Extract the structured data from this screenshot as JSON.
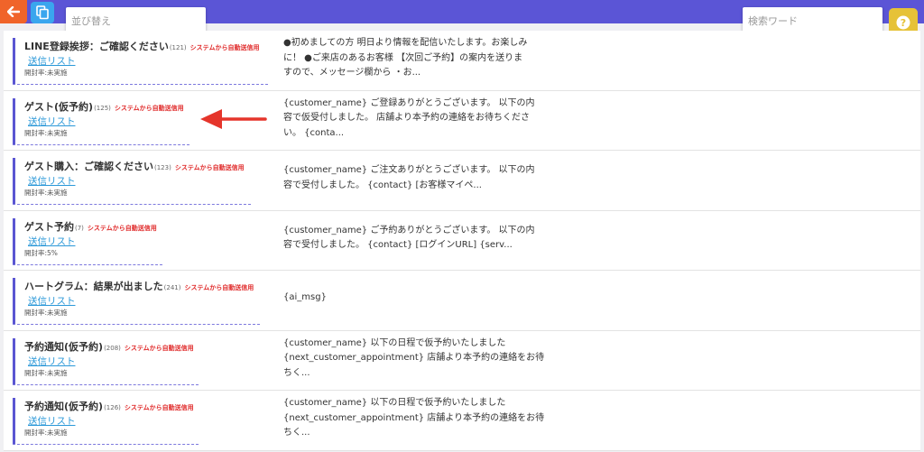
{
  "toolbar": {
    "sort_placeholder": "並び替え",
    "search_placeholder": "検索ワード",
    "back_icon": "arrow-left-icon",
    "copy_icon": "copy-icon",
    "help_icon": "question-icon",
    "add_icon": "plus-icon"
  },
  "colors": {
    "topbar": "#5b55d6",
    "back": "#f0642a",
    "copy": "#3aa6ee",
    "help": "#e6c237",
    "add": "#e8474c",
    "accent_bar": "#5a55d2",
    "auto_label": "#e02b2b",
    "link": "#2b98d8",
    "annotation_arrow": "#e5352b"
  },
  "messages": [
    {
      "title": "LINE登録挨拶：ご確認ください",
      "count": "(121)",
      "auto_label": "システムから自動送信用",
      "link": "送信リスト",
      "open_rate": "開封率:未実施",
      "body_lines": [
        "●初めましての方 明日より情報を配信いたします。お楽しみ",
        "に！ ●ご来店のあるお客様 【次回ご予約】の案内を送りま",
        "すので、メッセージ欄から ・お..."
      ]
    },
    {
      "title": "ゲスト(仮予約)",
      "count": "(125)",
      "auto_label": "システムから自動送信用",
      "link": "送信リスト",
      "open_rate": "開封率:未実施",
      "body_lines": [
        "{customer_name} ご登録ありがとうございます。 以下の内",
        "容で仮受付しました。 店舗より本予約の連絡をお待ちくださ",
        "い。 {conta..."
      ]
    },
    {
      "title": "ゲスト購入：ご確認ください",
      "count": "(123)",
      "auto_label": "システムから自動送信用",
      "link": "送信リスト",
      "open_rate": "開封率:未実施",
      "body_lines": [
        "{customer_name} ご注文ありがとうございます。 以下の内",
        "容で受付しました。 {contact} [お客様マイペ..."
      ]
    },
    {
      "title": "ゲスト予約",
      "count": "(7)",
      "auto_label": "システムから自動送信用",
      "link": "送信リスト",
      "open_rate": "開封率:5%",
      "body_lines": [
        "{customer_name} ご予約ありがとうございます。 以下の内",
        "容で受付しました。 {contact} [ログインURL] {serv..."
      ]
    },
    {
      "title": "ハートグラム：結果が出ました",
      "count": "(241)",
      "auto_label": "システムから自動送信用",
      "link": "送信リスト",
      "open_rate": "開封率:未実施",
      "body_lines": [
        "{ai_msg}"
      ]
    },
    {
      "title": "予約通知(仮予約)",
      "count": "(208)",
      "auto_label": "システムから自動送信用",
      "link": "送信リスト",
      "open_rate": "開封率:未実施",
      "body_lines": [
        "{customer_name} 以下の日程で仮予約いたしました",
        "{next_customer_appointment} 店舗より本予約の連絡をお待",
        "ちく..."
      ]
    },
    {
      "title": "予約通知(仮予約)",
      "count": "(126)",
      "auto_label": "システムから自動送信用",
      "link": "送信リスト",
      "open_rate": "開封率:未実施",
      "body_lines": [
        "{customer_name} 以下の日程で仮予約いたしました",
        "{next_customer_appointment} 店舗より本予約の連絡をお待",
        "ちく..."
      ]
    }
  ]
}
